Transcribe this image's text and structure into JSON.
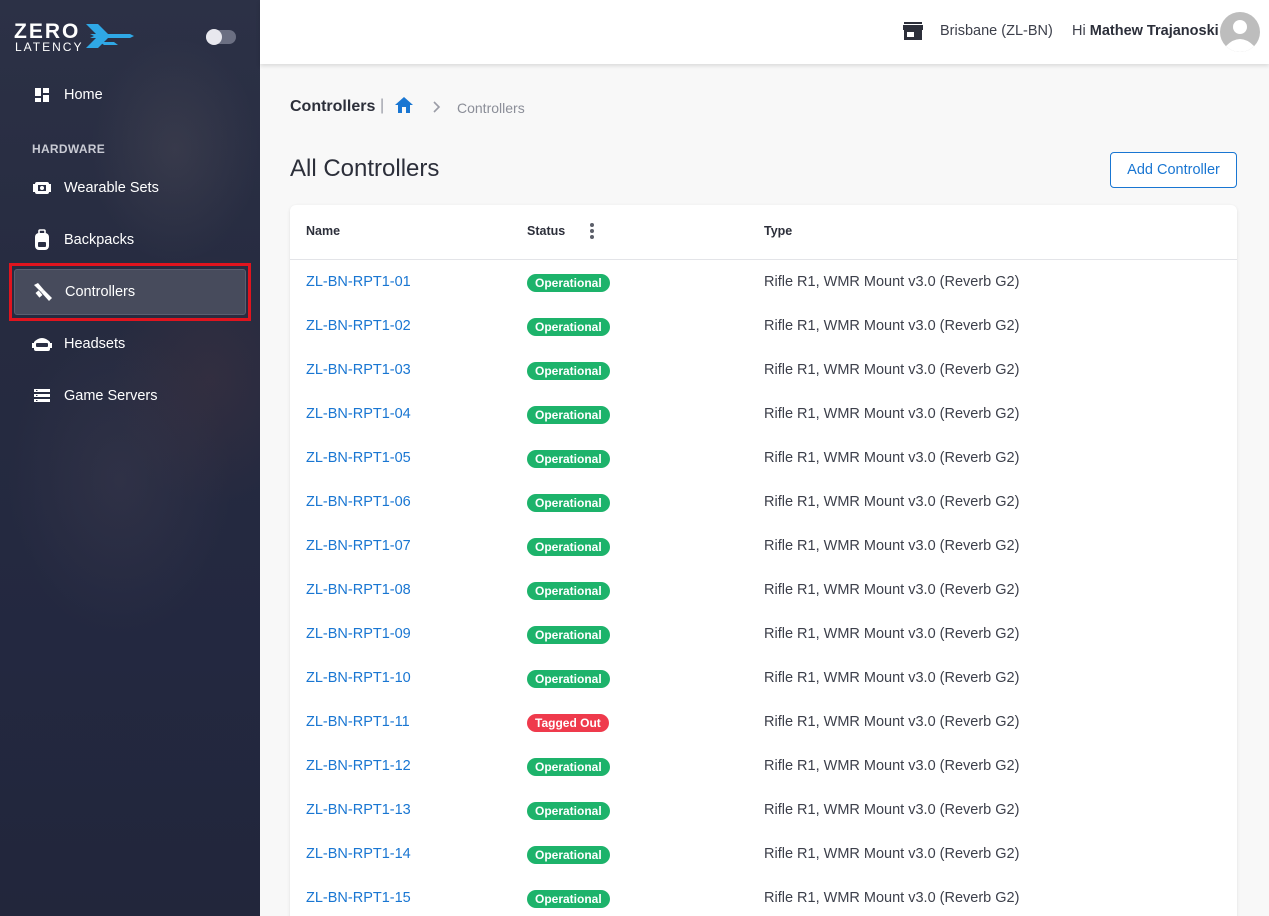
{
  "brand": {
    "line1": "ZERO",
    "line2": "LATENCY"
  },
  "sidebar": {
    "home": "Home",
    "section": "HARDWARE",
    "items": [
      {
        "label": "Wearable Sets",
        "icon": "wearable-icon"
      },
      {
        "label": "Backpacks",
        "icon": "backpack-icon"
      },
      {
        "label": "Controllers",
        "icon": "controller-icon",
        "active": true
      },
      {
        "label": "Headsets",
        "icon": "headset-icon"
      },
      {
        "label": "Game Servers",
        "icon": "server-icon"
      }
    ]
  },
  "header": {
    "location": "Brisbane (ZL-BN)",
    "greeting": "Hi",
    "user": "Mathew Trajanoski"
  },
  "breadcrumb": {
    "title": "Controllers",
    "separator": "|",
    "current": "Controllers"
  },
  "page": {
    "title": "All Controllers",
    "add_button": "Add Controller"
  },
  "table": {
    "columns": {
      "name": "Name",
      "status": "Status",
      "type": "Type"
    },
    "rows": [
      {
        "name": "ZL-BN-RPT1-01",
        "status": "Operational",
        "type": "Rifle R1, WMR Mount v3.0 (Reverb G2)"
      },
      {
        "name": "ZL-BN-RPT1-02",
        "status": "Operational",
        "type": "Rifle R1, WMR Mount v3.0 (Reverb G2)"
      },
      {
        "name": "ZL-BN-RPT1-03",
        "status": "Operational",
        "type": "Rifle R1, WMR Mount v3.0 (Reverb G2)"
      },
      {
        "name": "ZL-BN-RPT1-04",
        "status": "Operational",
        "type": "Rifle R1, WMR Mount v3.0 (Reverb G2)"
      },
      {
        "name": "ZL-BN-RPT1-05",
        "status": "Operational",
        "type": "Rifle R1, WMR Mount v3.0 (Reverb G2)"
      },
      {
        "name": "ZL-BN-RPT1-06",
        "status": "Operational",
        "type": "Rifle R1, WMR Mount v3.0 (Reverb G2)"
      },
      {
        "name": "ZL-BN-RPT1-07",
        "status": "Operational",
        "type": "Rifle R1, WMR Mount v3.0 (Reverb G2)"
      },
      {
        "name": "ZL-BN-RPT1-08",
        "status": "Operational",
        "type": "Rifle R1, WMR Mount v3.0 (Reverb G2)"
      },
      {
        "name": "ZL-BN-RPT1-09",
        "status": "Operational",
        "type": "Rifle R1, WMR Mount v3.0 (Reverb G2)"
      },
      {
        "name": "ZL-BN-RPT1-10",
        "status": "Operational",
        "type": "Rifle R1, WMR Mount v3.0 (Reverb G2)"
      },
      {
        "name": "ZL-BN-RPT1-11",
        "status": "Tagged Out",
        "type": "Rifle R1, WMR Mount v3.0 (Reverb G2)"
      },
      {
        "name": "ZL-BN-RPT1-12",
        "status": "Operational",
        "type": "Rifle R1, WMR Mount v3.0 (Reverb G2)"
      },
      {
        "name": "ZL-BN-RPT1-13",
        "status": "Operational",
        "type": "Rifle R1, WMR Mount v3.0 (Reverb G2)"
      },
      {
        "name": "ZL-BN-RPT1-14",
        "status": "Operational",
        "type": "Rifle R1, WMR Mount v3.0 (Reverb G2)"
      },
      {
        "name": "ZL-BN-RPT1-15",
        "status": "Operational",
        "type": "Rifle R1, WMR Mount v3.0 (Reverb G2)"
      }
    ]
  },
  "colors": {
    "sidebar_bg": "#262b40",
    "link": "#1976d2",
    "status_ok": "#1db36b",
    "status_bad": "#ef3a4c",
    "highlight": "#e0141e"
  }
}
